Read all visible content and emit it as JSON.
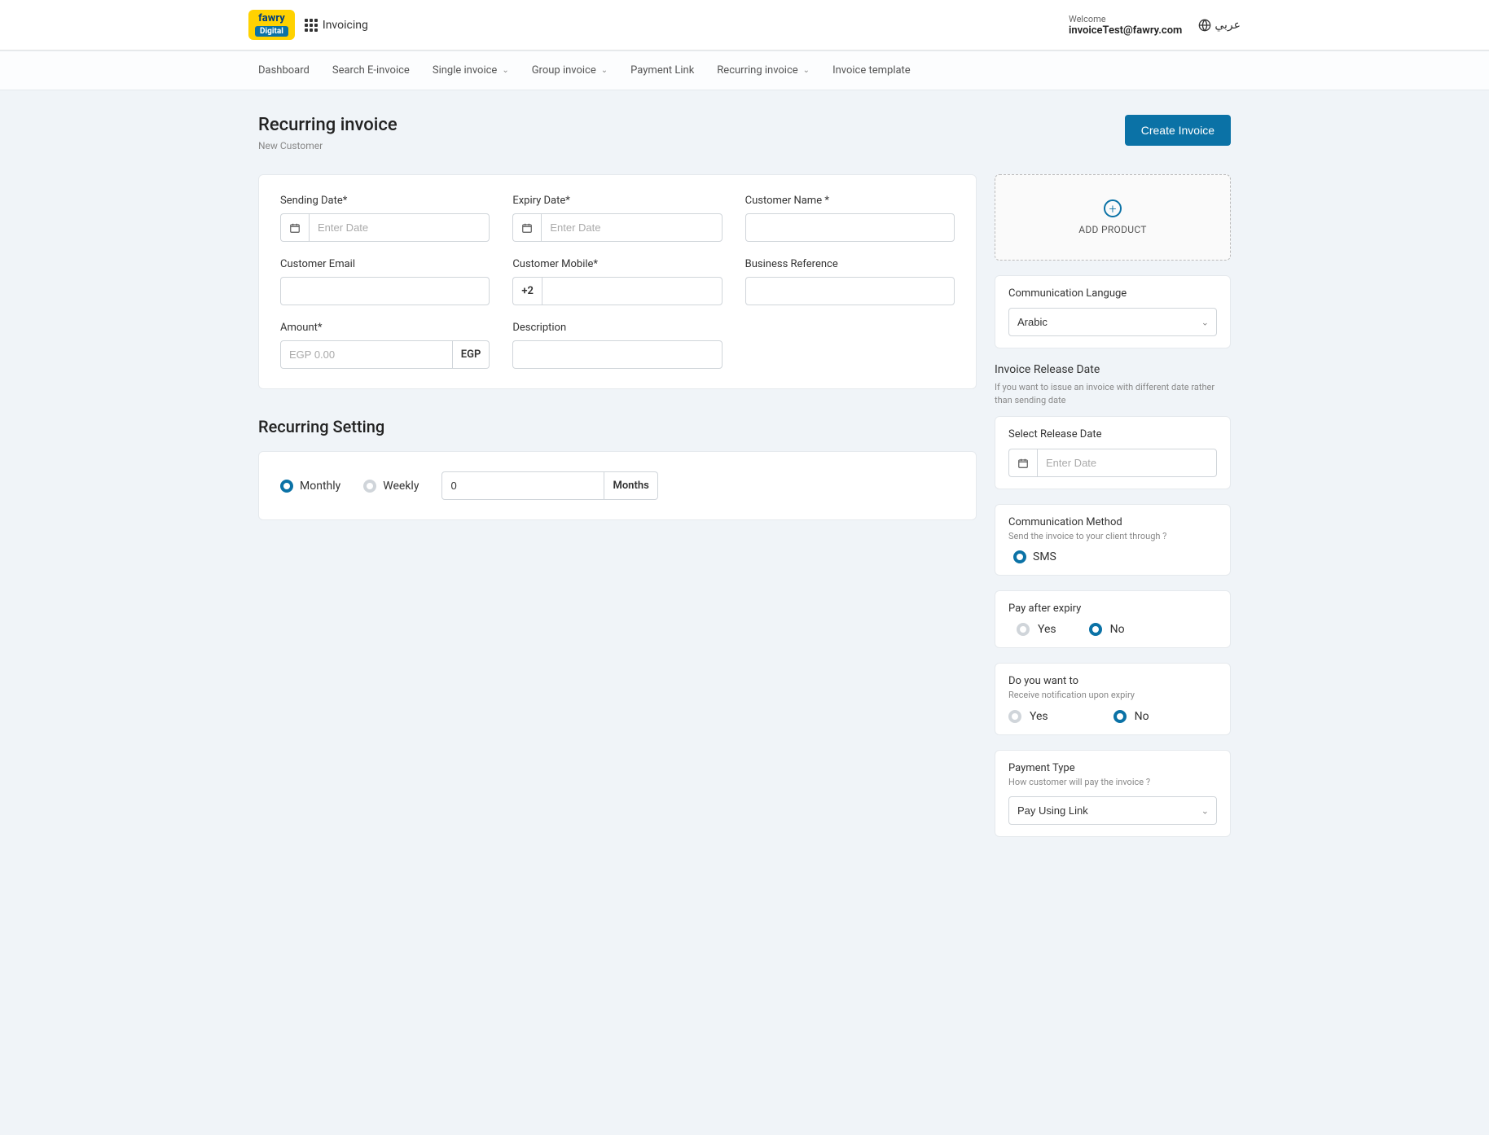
{
  "header": {
    "logo_main": "fawry",
    "logo_sub": "Digital",
    "app_name": "Invoicing",
    "welcome_label": "Welcome",
    "user_email": "invoiceTest@fawry.com",
    "lang_label": "عربي"
  },
  "nav": {
    "dashboard": "Dashboard",
    "search_einvoice": "Search E-invoice",
    "single_invoice": "Single invoice",
    "group_invoice": "Group invoice",
    "payment_link": "Payment Link",
    "recurring_invoice": "Recurring invoice",
    "invoice_template": "Invoice template"
  },
  "page": {
    "title": "Recurring invoice",
    "subtitle": "New Customer",
    "create_btn": "Create Invoice"
  },
  "form": {
    "sending_date_label": "Sending Date*",
    "sending_date_placeholder": "Enter Date",
    "expiry_date_label": "Expiry Date*",
    "expiry_date_placeholder": "Enter Date",
    "customer_name_label": "Customer Name *",
    "customer_email_label": "Customer Email",
    "customer_mobile_label": "Customer Mobile*",
    "mobile_prefix": "+2",
    "business_ref_label": "Business Reference",
    "amount_label": "Amount*",
    "amount_placeholder": "EGP 0.00",
    "amount_currency": "EGP",
    "description_label": "Description"
  },
  "recurring": {
    "section_title": "Recurring Setting",
    "monthly_label": "Monthly",
    "weekly_label": "Weekly",
    "duration_value": "0",
    "duration_unit": "Months"
  },
  "side": {
    "add_product": "ADD PRODUCT",
    "comm_lang_label": "Communication Languge",
    "comm_lang_value": "Arabic",
    "release_title": "Invoice Release Date",
    "release_hint": "If you want to issue an invoice with different date rather than sending date",
    "release_select_label": "Select Release Date",
    "release_placeholder": "Enter Date",
    "comm_method_label": "Communication Method",
    "comm_method_hint": "Send the invoice to your client through ?",
    "comm_method_sms": "SMS",
    "pay_after_expiry_label": "Pay after expiry",
    "yes": "Yes",
    "no": "No",
    "notify_label": "Do you want to",
    "notify_hint": "Receive notification upon expiry",
    "payment_type_label": "Payment Type",
    "payment_type_hint": "How customer will pay the invoice ?",
    "payment_type_value": "Pay Using Link"
  }
}
